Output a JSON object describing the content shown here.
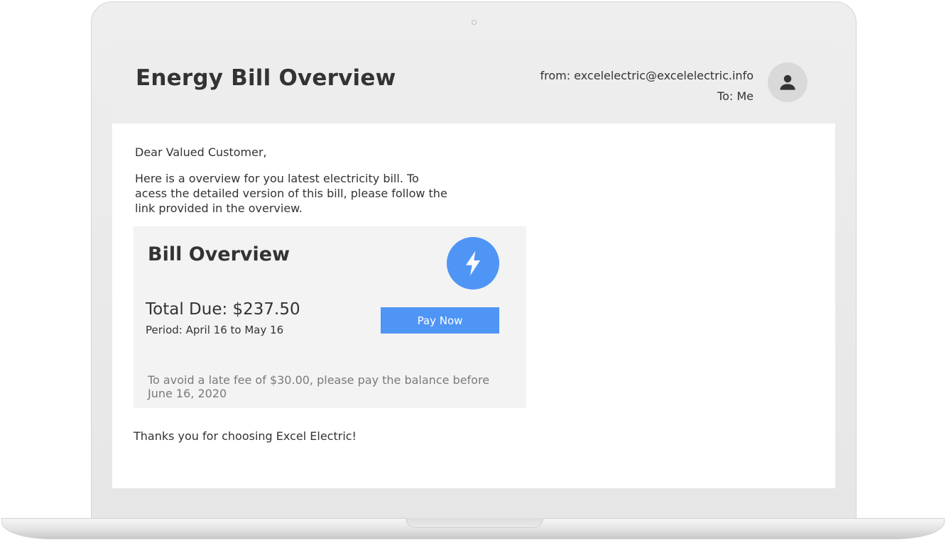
{
  "email": {
    "title": "Energy Bill Overview",
    "from_line": "from: excelelectric@excelelectric.info",
    "to_line": "To: Me",
    "greeting": "Dear Valued Customer,",
    "intro": "Here is a overview for you latest electricity bill. To acess the detailed version of this bill, please follow the link provided in the overview.",
    "closing": "Thanks you for choosing Excel Electric!"
  },
  "bill": {
    "title": "Bill Overview",
    "total_due": "Total Due: $237.50",
    "period": "Period: April 16 to May 16",
    "pay_label": "Pay Now",
    "late_fee_note": "To avoid a late fee of $30.00, please pay the balance before June 16, 2020"
  },
  "icons": {
    "avatar": "user-icon",
    "badge": "lightning-bolt-icon"
  },
  "colors": {
    "accent": "#4f95f5",
    "header_bg": "#ededed",
    "card_bg": "#f3f3f3",
    "text": "#333333",
    "muted_text": "#7a7a7a"
  }
}
